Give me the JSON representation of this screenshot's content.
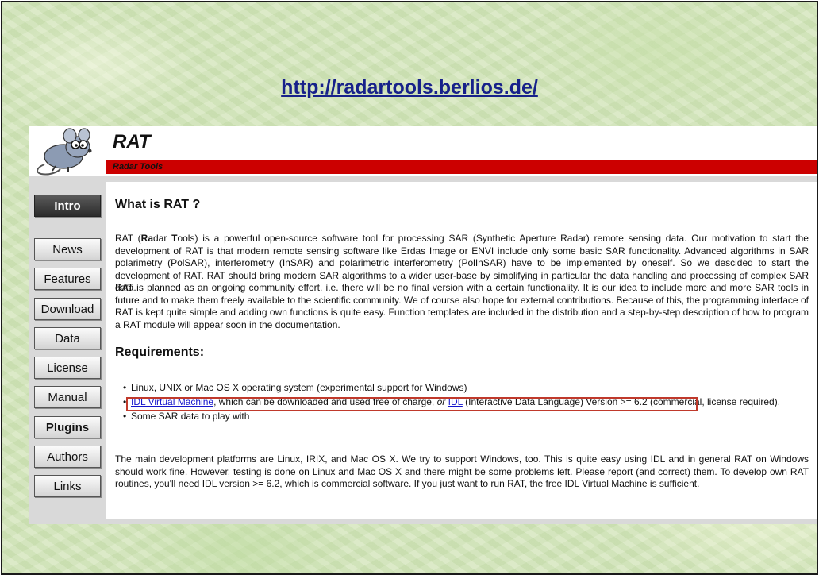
{
  "slide": {
    "url": "http://radartools.berlios.de/"
  },
  "site": {
    "title": "RAT",
    "subtitle": "Radar Tools"
  },
  "nav": [
    {
      "label": "Intro"
    },
    {
      "label": "News"
    },
    {
      "label": "Features"
    },
    {
      "label": "Download"
    },
    {
      "label": "Data"
    },
    {
      "label": "License"
    },
    {
      "label": "Manual"
    },
    {
      "label": "Plugins"
    },
    {
      "label": "Authors"
    },
    {
      "label": "Links"
    }
  ],
  "content": {
    "heading_what": "What is RAT ?",
    "para1_pre": "RAT (",
    "para1_bold": "Ra",
    "para1_mid": "dar ",
    "para1_bold2": "T",
    "para1_rest": "ools) is a powerful open-source software tool for processing SAR (Synthetic Aperture Radar) remote sensing data. Our motivation to start the development of RAT is that modern remote sensing software like Erdas Image or ENVI include only some basic SAR functionality. Advanced algorithms in SAR polarimetry (PolSAR), interferometry (InSAR) and polarimetric interferometry (PolInSAR) have to be implemented by oneself. So we descided to start the development of RAT. RAT should bring modern SAR algorithms to a wider user-base by simplifying in particular the data handling and processing of complex SAR data.",
    "para2": "RAT is planned as an ongoing community effort, i.e. there will be no final version with a certain functionality. It is our idea to include more and more SAR tools in future and to make them freely available to the scientific community. We of course also hope for external contributions. Because of this, the programming interface of RAT is kept quite simple and adding own functions is quite easy. Function templates are included in the distribution and a step-by-step description of how to program a RAT module will appear soon in the documentation.",
    "heading_req": "Requirements:",
    "req1": "Linux, UNIX or Mac OS X operating system (experimental support for Windows)",
    "req2_link1": "IDL Virtual Machine",
    "req2_mid": ", which can be downloaded and used free of charge, ",
    "req2_or": "or",
    "req2_link2": "IDL",
    "req2_rest": " (Interactive Data Language) Version >= 6.2 (commercial, license required).",
    "req3": "Some SAR data to play with",
    "para3": "The main development platforms are Linux, IRIX, and Mac OS X. We try to support Windows, too. This is quite easy using IDL and in general RAT on Windows should work fine. However, testing is done on Linux and Mac OS X and there might be some problems left. Please report (and correct) them. To develop own RAT routines, you'll need IDL version >= 6.2, which is commercial software. If you just want to run RAT, the free IDL Virtual Machine is sufficient."
  }
}
